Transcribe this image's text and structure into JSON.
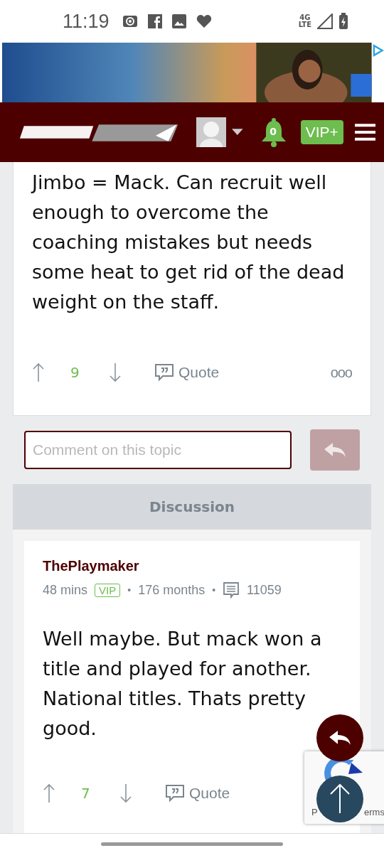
{
  "status_bar": {
    "time": "11:19",
    "network": "4G",
    "network_sub": "LTE"
  },
  "header": {
    "notifications": "0",
    "vip_button": "VIP+"
  },
  "posts": [
    {
      "body": "Jimbo = Mack. Can recruit well enough to overcome the coaching mistakes but needs some heat to get rid of the dead weight on the staff.",
      "votes": "9",
      "quote": "Quote",
      "more": "ooo"
    }
  ],
  "comment": {
    "placeholder": "Comment on this topic"
  },
  "discussion": {
    "title": "Discussion"
  },
  "replies": [
    {
      "author": "ThePlaymaker",
      "time": "48 mins",
      "badge": "VIP",
      "separator": "•",
      "tenure": "176 months",
      "separator_2": "•",
      "posts": "11059",
      "body": "Well maybe. But mack won a title and played for another. National titles. Thats pretty good.",
      "votes": "7",
      "quote": "Quote"
    }
  ],
  "recaptcha": {
    "left": "P",
    "right": "erms"
  }
}
